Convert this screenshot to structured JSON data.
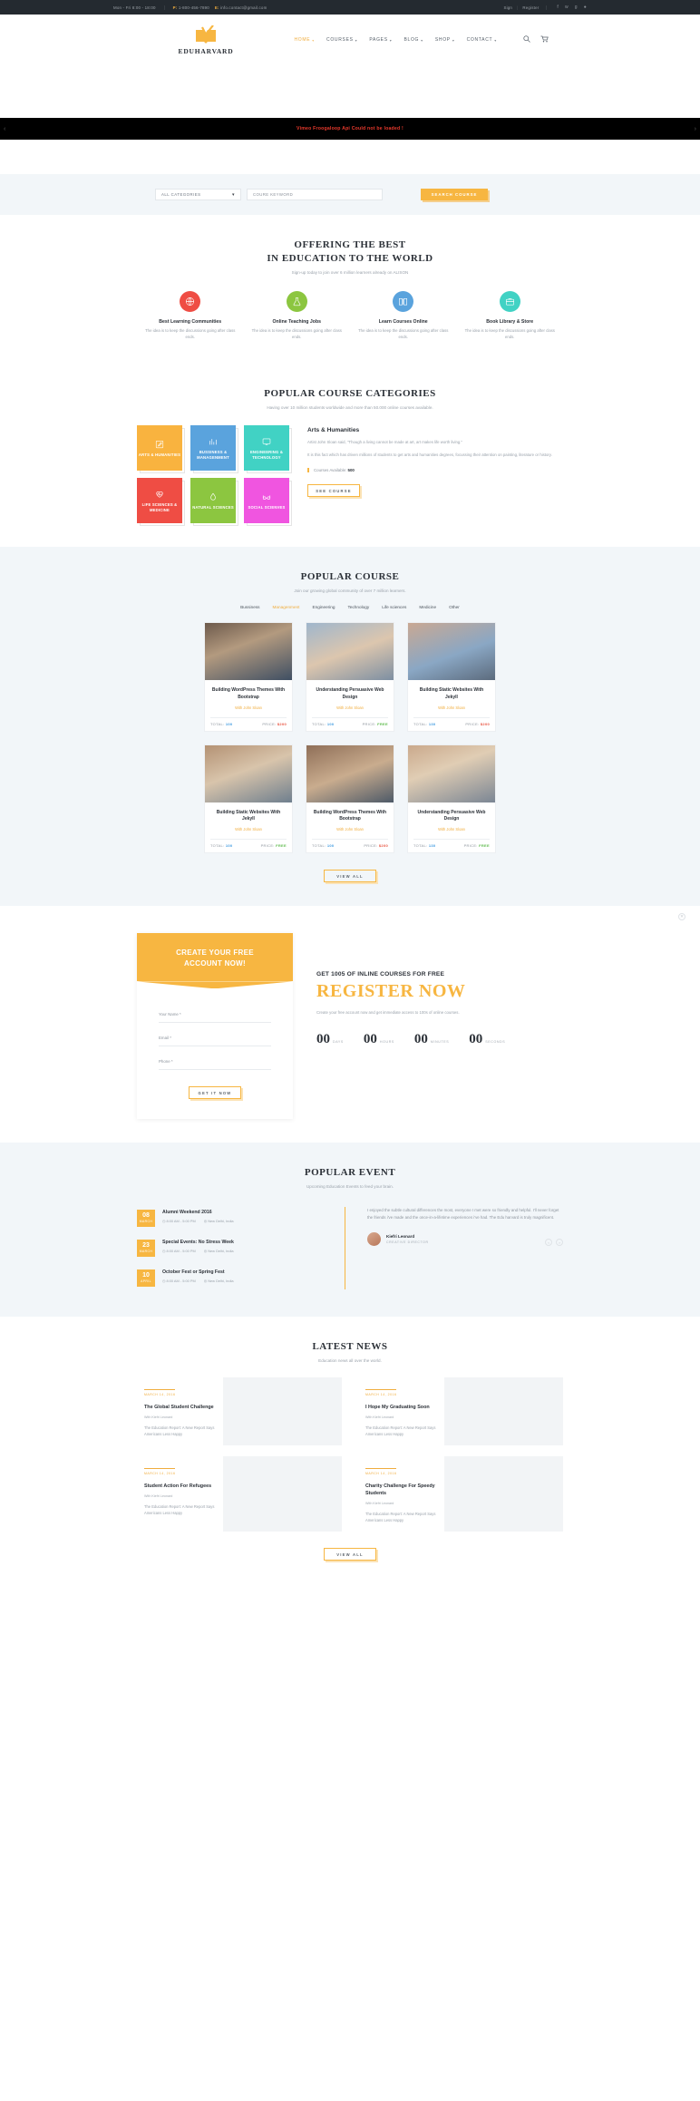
{
  "topbar": {
    "hours": "Mon - Fri 8:00 - 18:00",
    "phone_key": "P:",
    "phone": "1-800-456-7890",
    "email_key": "E:",
    "email": "info.contact@gmail.com",
    "sign": "Sign",
    "separator": "|",
    "register": "Register",
    "social": [
      "facebook-icon",
      "twitter-icon",
      "google-plus-icon",
      "dribbble-icon"
    ]
  },
  "header": {
    "brand": "EDUHARVARD",
    "logo_icon": "open-book-logo-icon",
    "nav": [
      {
        "label": "HOME",
        "caret": "⌄",
        "active": true
      },
      {
        "label": "COURSES",
        "caret": "⌄",
        "active": false
      },
      {
        "label": "PAGES",
        "caret": "⌄",
        "active": false
      },
      {
        "label": "BLOG",
        "caret": "⌄",
        "active": false
      },
      {
        "label": "SHOP",
        "caret": "⌄",
        "active": false
      },
      {
        "label": "CONTACT",
        "caret": "⌄",
        "active": false
      }
    ],
    "search_icon": "search-icon",
    "cart_icon": "shopping-cart-icon"
  },
  "error_banner": {
    "message": "Vimeo Froogaloop Api Could not be loaded !",
    "left_arrow": "‹",
    "right_arrow": "›",
    "color": "#e8392c",
    "background": "#000000"
  },
  "search": {
    "category_value": "ALL CATEGORIES",
    "category_caret": "⌄",
    "keyword_placeholder": "COURE KEYWORD",
    "button": "SEARCH COURSE"
  },
  "offering": {
    "title_line1": "OFFERING THE BEST",
    "title_line2": "IN EDUCATION TO THE WORLD",
    "subtitle": "Sign-up today to join over 6 million learners already on ALISON",
    "features": [
      {
        "title": "Best Learning Communities",
        "desc": "The idea is to keep the discussions going after class ends.",
        "icon": "globe-icon",
        "color": "#ef4d44"
      },
      {
        "title": "Online Teaching Jobs",
        "desc": "The idea is to keep the discussions going after class ends.",
        "icon": "flask-icon",
        "color": "#8cc640"
      },
      {
        "title": "Learn Courses Online",
        "desc": "The idea is to keep the discussions going after class ends.",
        "icon": "open-book-icon",
        "color": "#5aa3dd"
      },
      {
        "title": "Book Library & Store",
        "desc": "The idea is to keep the discussions going after class ends.",
        "icon": "briefcase-icon",
        "color": "#41d2c4"
      }
    ]
  },
  "categories": {
    "title": "POPULAR COURSE CATEGORIES",
    "subtitle": "Having over 10 million students worldwide and more than 50.000 online courses available.",
    "tiles": [
      {
        "label": "ARTS & HUMANITIES",
        "color": "#f9b33f",
        "icon": "pencil-square-icon"
      },
      {
        "label": "BUSSINESS & MANAGENMENT",
        "color": "#5aa3dd",
        "icon": "bar-chart-icon"
      },
      {
        "label": "ENGINEERING & TECHNOLOGY",
        "color": "#41d2c4",
        "icon": "monitor-icon"
      },
      {
        "label": "LIFE SCIENCES & MEDICINE",
        "color": "#ef4d44",
        "icon": "heartbeat-icon"
      },
      {
        "label": "NATURAL SCIENCES",
        "color": "#8cc640",
        "icon": "water-drop-icon"
      },
      {
        "label": "SOCIAL SCIENVES",
        "color": "#f055e0",
        "icon": "glasses-icon"
      }
    ],
    "detail": {
      "heading": "Arts & Humanities",
      "quote": "Artist John Sloan said, \"Though a living cannot be made at art, art makes life worth living.\"",
      "body": "It is this fact which has driven millions of students to get arts and humanities degrees, focussing their attention on painting, literature or history.",
      "available_label": "Courses Available:",
      "available_count": "500",
      "button": "SEE COURSE"
    }
  },
  "popular_course": {
    "title": "POPULAR COURSE",
    "subtitle": "Join our growing global community of over 7 million learners.",
    "tabs": [
      {
        "label": "Bussiness",
        "active": false
      },
      {
        "label": "Managenment",
        "active": true
      },
      {
        "label": "Engineering",
        "active": false
      },
      {
        "label": "Technology",
        "active": false
      },
      {
        "label": "Life sciences",
        "active": false
      },
      {
        "label": "Medicine",
        "active": false
      },
      {
        "label": "Other",
        "active": false
      }
    ],
    "total_label": "TOTAL:",
    "price_label": "PRICE:",
    "cards": [
      {
        "title": "Building WordPress Themes With Bootstrap",
        "author": "With John Sloan",
        "total": "100",
        "price": "$200",
        "price_kind": "paid",
        "img": "students-library-photo"
      },
      {
        "title": "Understanding Persuasive Web Design",
        "author": "With John Sloan",
        "total": "100",
        "price": "FREE",
        "price_kind": "free",
        "img": "teacher-classroom-photo"
      },
      {
        "title": "Building Static Websites With Jekyll",
        "author": "With John Sloan",
        "total": "130",
        "price": "$200",
        "price_kind": "paid",
        "img": "students-group-photo"
      },
      {
        "title": "Building Static Websites With Jekyll",
        "author": "With John Sloan",
        "total": "100",
        "price": "FREE",
        "price_kind": "free",
        "img": "study-table-photo"
      },
      {
        "title": "Building WordPress Themes With Bootstrap",
        "author": "With John Sloan",
        "total": "100",
        "price": "$200",
        "price_kind": "paid",
        "img": "students-laptop-photo"
      },
      {
        "title": "Understanding Persuasive Web Design",
        "author": "With John Sloan",
        "total": "130",
        "price": "FREE",
        "price_kind": "free",
        "img": "girls-studying-photo"
      }
    ],
    "view_all": "VIEW ALL"
  },
  "register": {
    "card_title_line1": "CREATE YOUR FREE",
    "card_title_line2": "ACCOUNT NOW!",
    "fields": [
      {
        "label": "Your Name *"
      },
      {
        "label": "Email *"
      },
      {
        "label": "Phone *"
      }
    ],
    "submit": "GET IT NOW",
    "kicker": "GET 1005 OF INLINE COURSES FOR FREE",
    "headline": "REGISTER NOW",
    "paragraph": "Create your free account now and get immediate access to 100s of online courses.",
    "counters": [
      {
        "value": "00",
        "label": "DAYS"
      },
      {
        "value": "00",
        "label": "HOURS"
      },
      {
        "value": "00",
        "label": "MINUTES"
      },
      {
        "value": "00",
        "label": "SECONDS"
      }
    ]
  },
  "events": {
    "title": "POPULAR EVENT",
    "subtitle": "Upcoming Education Events to feed your brain.",
    "items": [
      {
        "day": "08",
        "month": "MARCH",
        "title": "Alumni Weekend 2016",
        "time": "8:00 AM - 5:00 PM",
        "place": "New Delhi, India"
      },
      {
        "day": "23",
        "month": "MARCH",
        "title": "Special Events: No Stress Week",
        "time": "8:00 AM - 5:00 PM",
        "place": "New Delhi, India"
      },
      {
        "day": "10",
        "month": "APRIL",
        "title": "October Fest or Spring Fest",
        "time": "8:00 AM - 5:00 PM",
        "place": "New Delhi, India"
      }
    ],
    "quote": "I enjoyed the subtle cultural differences the most, everyone I met were so friendly and helpful.  I'll never forget the friends i've made and the once-in-a-lifetime experiences i've had. The Edu harvard is truly magnificent.",
    "author_name": "Kiefri Leonard",
    "author_role": "CREATIVE DIRECTOR",
    "prev_icon": "chevron-left-icon",
    "next_icon": "chevron-right-icon"
  },
  "news": {
    "title": "LATEST NEWS",
    "subtitle": "Education news all over the world.",
    "items": [
      {
        "date": "MARCH 14, 2016",
        "title": "The Global Student Challenge",
        "by": "With Kiefri Leonard",
        "excerpt": "The Education Report: A New Report Says Americans Less Happy",
        "img": "classroom-photo"
      },
      {
        "date": "MARCH 14, 2016",
        "title": "I Hope My Graduating Soon",
        "by": "With Kiefri Leonard",
        "excerpt": "The Education Report: A New Report Says Americans Less Happy",
        "img": "graduation-photo"
      },
      {
        "date": "MARCH 14, 2016",
        "title": "Student Action For Refugees",
        "by": "With Kiefri Leonard",
        "excerpt": "The Education Report: A New Report Says Americans Less Happy",
        "img": "students-outdoor-photo"
      },
      {
        "date": "MARCH 14, 2016",
        "title": "Charity Challenge For Speedy Students",
        "by": "With Kiefri Leonard",
        "excerpt": "The Education Report: A New Report Says Americans Less Happy",
        "img": "charity-run-photo"
      }
    ],
    "view_all": "VIEW ALL"
  },
  "colors": {
    "accent": "#f7b641",
    "dark": "#242a30",
    "grey_bg": "#f2f6f9",
    "text": "#2c3138",
    "muted": "#9aa2ab"
  }
}
